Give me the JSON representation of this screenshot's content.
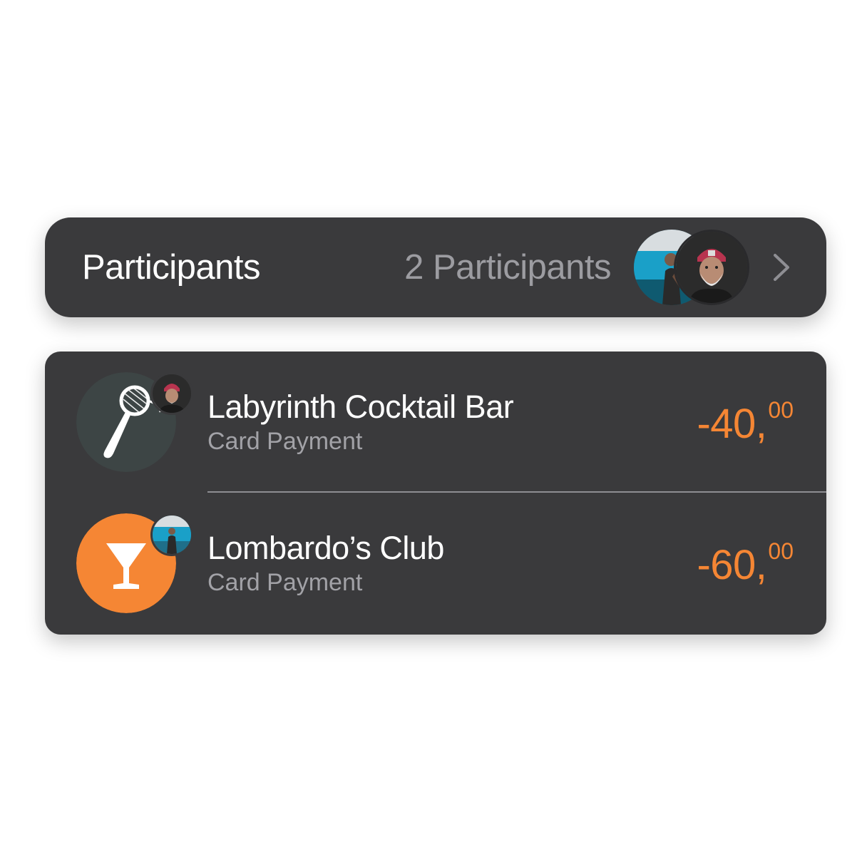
{
  "participants": {
    "title": "Participants",
    "count_label": "2 Participants",
    "avatars": [
      "participant-1",
      "participant-2"
    ]
  },
  "transactions": [
    {
      "merchant": "Labyrinth Cocktail Bar",
      "type": "Card Payment",
      "amount_whole": "-40,",
      "amount_cents": "00",
      "icon": "strainer-icon",
      "icon_bg": "#3d4545"
    },
    {
      "merchant": "Lombardo’s Club",
      "type": "Card Payment",
      "amount_whole": "-60,",
      "amount_cents": "00",
      "icon": "cocktail-glass-icon",
      "icon_bg": "#f58634"
    }
  ],
  "colors": {
    "card_bg": "#3a3a3c",
    "amount": "#f58634",
    "secondary_text": "#9c9ca1"
  }
}
